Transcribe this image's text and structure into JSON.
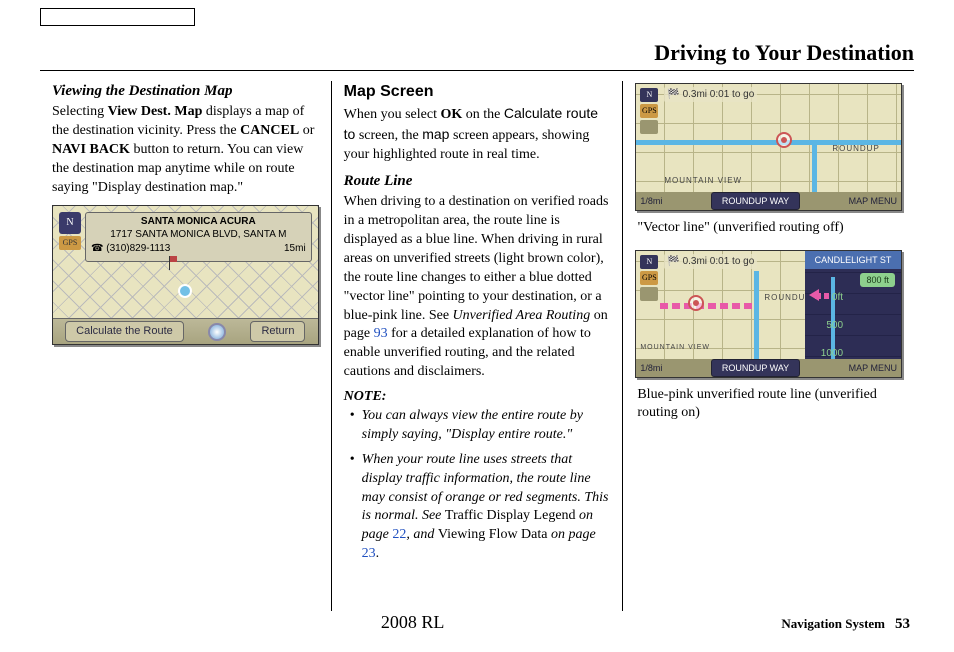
{
  "header": {
    "title": "Driving to Your Destination"
  },
  "footer": {
    "model": "2008  RL",
    "section_label": "Navigation System",
    "page_number": "53"
  },
  "col1": {
    "heading": "Viewing the Destination Map",
    "para1_a": " Selecting ",
    "para1_b": "View Dest. Map",
    "para1_c": " displays a map of the destination vicinity. Press the ",
    "para1_d": "CANCEL",
    "para1_e": " or ",
    "para1_f": "NAVI BACK",
    "para1_g": " button to return. You can view the destination map anytime while on route saying \"Display destination map.\"",
    "fig1": {
      "title_line1": "SANTA MONICA ACURA",
      "title_line2": "1717 SANTA MONICA BLVD, SANTA M",
      "phone": "(310)829-1113",
      "distance": "15mi",
      "btn_calc": "Calculate the Route",
      "btn_return": "Return",
      "compass": "N",
      "gps": "GPS"
    }
  },
  "col2": {
    "heading": "Map Screen",
    "para1_a": "When you select ",
    "para1_b": "OK",
    "para1_c": " on the ",
    "para1_d": "Calculate route to",
    "para1_e": " screen, the ",
    "para1_f": "map",
    "para1_g": " screen appears, showing your highlighted route in real time.",
    "sub_heading": "Route Line",
    "para2_a": "When driving to a destination on verified roads in a metropolitan area, the route line is displayed as a blue line. When driving in rural areas on unverified streets (light brown color), the route line changes to either a blue dotted \"vector line\" pointing to your destination, or a blue-pink line. See ",
    "para2_b": "Unverified Area Routing",
    "para2_c": " on page ",
    "para2_d": "93",
    "para2_e": " for a detailed explanation of how to enable unverified routing, and the related cautions and disclaimers.",
    "note_label": "NOTE:",
    "bullet1": "You can always view the entire route by simply saying, \"Display entire route.\"",
    "bullet2_a": "When your route line uses streets that display traffic information, the route line may consist of orange or red segments. This is normal. See ",
    "bullet2_b": "Traffic Display Legend",
    "bullet2_c": " on page ",
    "bullet2_d": "22",
    "bullet2_e": ", and ",
    "bullet2_f": "Viewing Flow Data",
    "bullet2_g": " on page ",
    "bullet2_h": "23",
    "bullet2_i": "."
  },
  "col3": {
    "fig_shared": {
      "compass": "N",
      "gps": "GPS",
      "top_distance": "0.3mi  0:01 to go",
      "scale": "1/8mi",
      "street_center": "ROUNDUP WAY",
      "map_menu": "MAP MENU",
      "label_roundup": "ROUNDUP",
      "label_mountain": "MOUNTAIN VIEW"
    },
    "caption1": "\"Vector line\" (unverified routing off)",
    "fig3": {
      "panel_title": "CANDLELIGHT ST",
      "marker": "800 ft",
      "d0": "0ft",
      "d500": "500",
      "d1000": "1000"
    },
    "caption2": " Blue-pink unverified route line (unverified routing on)"
  }
}
